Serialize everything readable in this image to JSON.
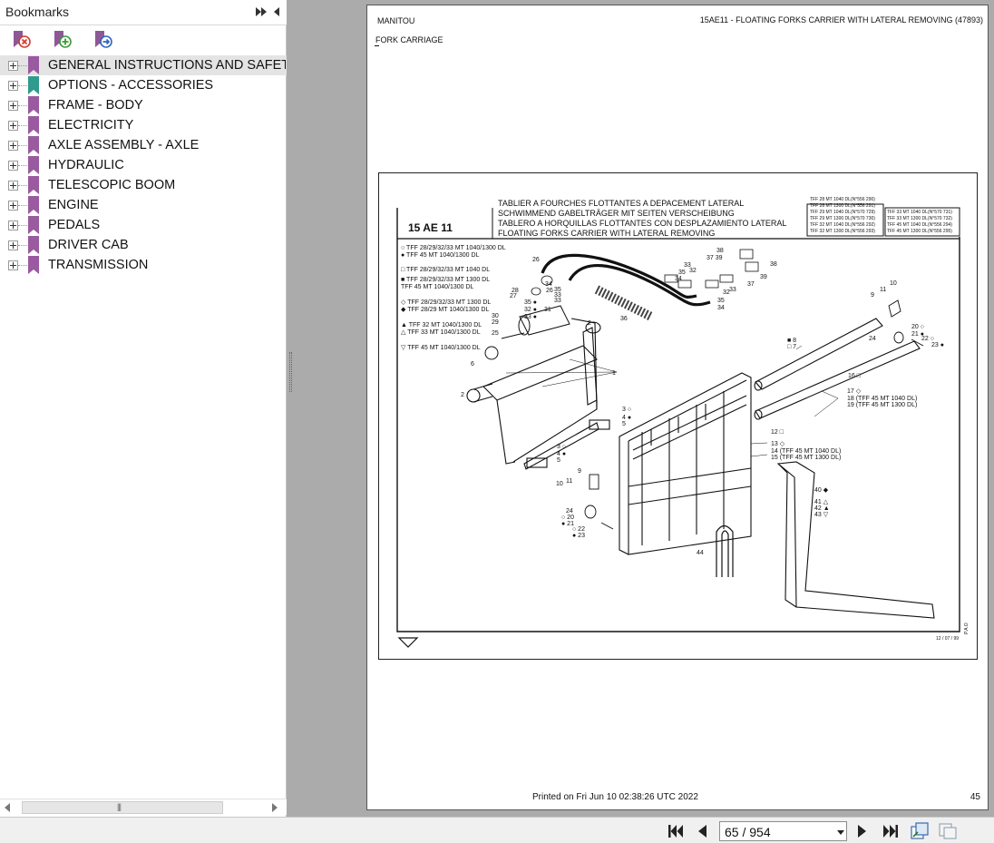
{
  "bookmarks": {
    "title": "Bookmarks",
    "toolbar": {
      "delete_icon": "delete-bookmark-icon",
      "add_icon": "add-bookmark-icon",
      "goto_icon": "goto-bookmark-icon"
    },
    "items": [
      {
        "label": "GENERAL INSTRUCTIONS AND SAFETY",
        "color": "#9a5aa0",
        "selected": true
      },
      {
        "label": "OPTIONS - ACCESSORIES",
        "color": "#2f9a8e",
        "selected": false
      },
      {
        "label": "FRAME - BODY",
        "color": "#9a5aa0",
        "selected": false
      },
      {
        "label": "ELECTRICITY",
        "color": "#9a5aa0",
        "selected": false
      },
      {
        "label": "AXLE ASSEMBLY - AXLE",
        "color": "#9a5aa0",
        "selected": false
      },
      {
        "label": "HYDRAULIC",
        "color": "#9a5aa0",
        "selected": false
      },
      {
        "label": "TELESCOPIC BOOM",
        "color": "#9a5aa0",
        "selected": false
      },
      {
        "label": "ENGINE",
        "color": "#9a5aa0",
        "selected": false
      },
      {
        "label": "PEDALS",
        "color": "#9a5aa0",
        "selected": false
      },
      {
        "label": "DRIVER CAB",
        "color": "#9a5aa0",
        "selected": false
      },
      {
        "label": "TRANSMISSION",
        "color": "#9a5aa0",
        "selected": false
      }
    ]
  },
  "page": {
    "brand": "MANITOU",
    "heading": "15AE11 - FLOATING FORKS CARRIER WITH LATERAL REMOVING (47893)",
    "subheading": "FORK CARRIAGE",
    "printed": "Printed on   Fri Jun 10 02:38:26 UTC 2022",
    "page_number": "45",
    "diagram": {
      "code": "15 AE 11",
      "titles": [
        "TABLIER A FOURCHES FLOTTANTES A DEPACEMENT LATERAL",
        "SCHWIMMEND GABELTRÄGER MIT SEITEN VERSCHEIBUNG",
        "TABLERO A HORQUILLAS FLOTTANTES CON DESPLAZAMIENTO LATERAL",
        "FLOATING FORKS CARRIER WITH LATERAL REMOVING"
      ],
      "serial_table_left": [
        "TFF 28 MT 1040 DL(N°556 290)",
        "TFF 28 MT 1300 DL(N°556 291)",
        "TFF 29 MT 1040 DL(N°570 729)",
        "TFF 29 MT 1300 DL(N°570 730)",
        "TFF 32 MT 1040 DL(N°556 292)",
        "TFF 32 MT 1300 DL(N°556 293)"
      ],
      "serial_table_right": [
        "TFF 33 MT 1040 DL(N°570 731)",
        "TFF 33 MT 1300 DL(N°570 732)",
        "TFF 45 MT 1040 DL(N°556 294)",
        "TFF 45 MT 1300 DL(N°556 295)"
      ],
      "legend": [
        "○ TFF 28/29/32/33 MT  1040/1300 DL",
        "● TFF 45 MT  1040/1300 DL",
        "□ TFF 28/29/32/33  MT 1040 DL",
        "■ TFF 28/29/32/33  MT 1300 DL",
        "    TFF 45 MT 1040/1300 DL",
        "◇ TFF 28/29/32/33 MT 1300 DL",
        "◆ TFF 28/29 MT 1040/1300 DL",
        "▲ TFF 32 MT 1040/1300 DL",
        "△ TFF 33 MT 1040/1300 DL",
        "▽ TFF 45 MT 1040/1300 DL"
      ],
      "callouts_right": [
        "18 (TFF 45 MT 1040 DL)",
        "19 (TFF 45 MT 1300 DL)",
        "14 (TFF 45 MT 1040 DL)",
        "15 (TFF 45 MT 1300 DL)"
      ],
      "date": "12 / 07 / 99",
      "pao": "P.A.O"
    }
  },
  "navigation": {
    "page_field": "65 / 954",
    "first_icon": "first-page-icon",
    "prev_icon": "previous-page-icon",
    "next_icon": "next-page-icon",
    "last_icon": "last-page-icon"
  }
}
